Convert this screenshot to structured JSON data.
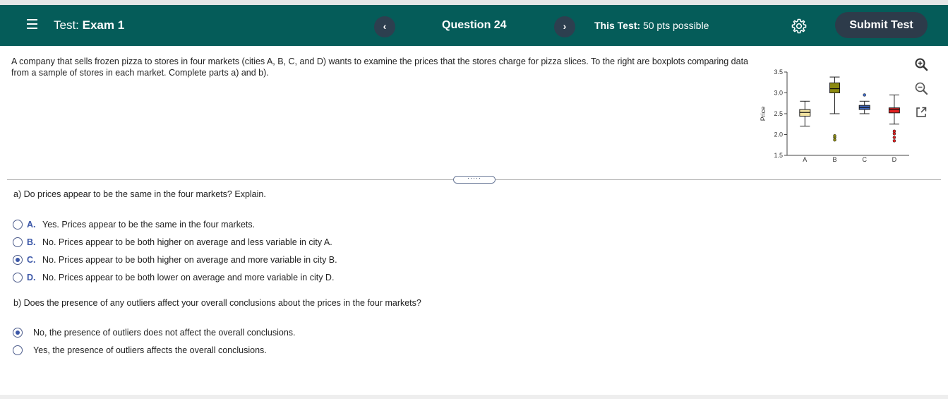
{
  "header": {
    "test_prefix": "Test:",
    "test_name": "Exam 1",
    "prev_label": "‹",
    "question_label": "Question 24",
    "next_label": "›",
    "points_prefix": "This Test:",
    "points_value": "50 pts possible",
    "submit_label": "Submit Test",
    "icons": [
      "menu-icon",
      "gear-icon"
    ]
  },
  "question": {
    "text": "A company that sells frozen pizza to stores in four markets (cities A, B, C, and D) wants to examine the prices that the stores charge for pizza slices. To the right are boxplots comparing data from a sample of stores in each market. Complete parts a) and b)."
  },
  "tools": [
    "zoom-in-icon",
    "zoom-out-icon",
    "popout-icon"
  ],
  "chart_data": {
    "type": "boxplot",
    "ylabel": "Price",
    "ylim": [
      1.5,
      3.5
    ],
    "yticks": [
      "1.5",
      "2.0",
      "2.5",
      "3.0",
      "3.5"
    ],
    "categories": [
      "A",
      "B",
      "C",
      "D"
    ],
    "boxes": [
      {
        "name": "A",
        "min": 2.2,
        "q1": 2.44,
        "median": 2.53,
        "q3": 2.6,
        "max": 2.8,
        "outliers": [],
        "color": "#f1e2a0"
      },
      {
        "name": "B",
        "min": 2.5,
        "q1": 3.0,
        "median": 3.1,
        "q3": 3.24,
        "max": 3.38,
        "outliers": [
          1.87,
          1.93,
          1.97
        ],
        "color": "#8c8a10"
      },
      {
        "name": "C",
        "min": 2.5,
        "q1": 2.6,
        "median": 2.65,
        "q3": 2.7,
        "max": 2.8,
        "outliers": [
          2.95
        ],
        "color": "#3f67bf"
      },
      {
        "name": "D",
        "min": 2.25,
        "q1": 2.52,
        "median": 2.6,
        "q3": 2.64,
        "max": 2.95,
        "outliers": [
          1.85,
          1.93,
          2.02,
          2.08
        ],
        "color": "#e02020"
      }
    ],
    "outlier_colors": {
      "B": "#8c8a10",
      "C": "#3f67bf",
      "D": "#e02020"
    },
    "grid": false
  },
  "part_a": {
    "question": "a) Do prices appear to be the same in the four markets? Explain.",
    "options": [
      {
        "letter": "A.",
        "text": "Yes. Prices appear to be the same in the four markets.",
        "checked": false
      },
      {
        "letter": "B.",
        "text": "No. Prices appear to be both higher on average and less variable in city A.",
        "checked": false
      },
      {
        "letter": "C.",
        "text": "No. Prices appear to be both higher on average and more variable in city B.",
        "checked": true
      },
      {
        "letter": "D.",
        "text": "No. Prices appear to be both lower on average and more variable in city D.",
        "checked": false
      }
    ]
  },
  "part_b": {
    "question": "b) Does the presence of any outliers affect your overall conclusions about the prices in the four markets?",
    "options": [
      {
        "text": "No, the presence of outliers does not affect the overall conclusions.",
        "checked": true
      },
      {
        "text": "Yes, the presence of outliers affects the overall conclusions.",
        "checked": false
      }
    ]
  },
  "colors": {
    "header_bg": "#055c59",
    "button_dark": "#2d3b4a",
    "accent": "#3b57a8"
  }
}
